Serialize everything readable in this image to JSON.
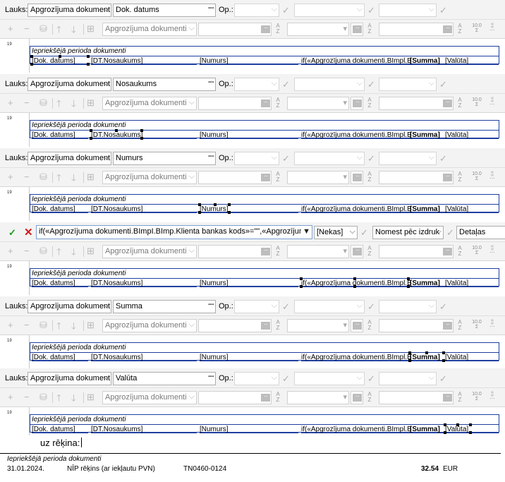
{
  "lauks_label": "Lauks:",
  "op_label": "Op.:",
  "table_name": "Apgrozījuma dokument",
  "toolbar2_combo": "Apgrozījuma dokumenti",
  "ruler_mark": "19",
  "band_header": "Iepriekšējā perioda dokumenti",
  "fields": {
    "dok_datums": "[Dok. datums]",
    "dt_nosaukums": "[DT.Nosaukums]",
    "numurs": "[Numurs]",
    "if_expr": "if(«Apgrozījuma dokumenti.BImpl.B",
    "summa": "[Summa]",
    "valuta": "[Valūta]"
  },
  "panels": [
    {
      "field": "Dok. datums",
      "selected": "dok_datums"
    },
    {
      "field": "Nosaukums",
      "selected": "dt_nosaukums"
    },
    {
      "field": "Numurs",
      "selected": "numurs"
    },
    {
      "field": "",
      "selected": "if_expr"
    },
    {
      "field": "Summa",
      "selected": "summa"
    },
    {
      "field": "Valūta",
      "selected": "valuta"
    }
  ],
  "edit_bar": {
    "expression": "if(«Apgrozījuma dokumenti.BImpI.BImp.Klienta bankas kods»=\"\",«Apgrozījuma dokuņ",
    "nekas": "[Nekas]",
    "nomest": "Nomest pēc izdruk",
    "detalas": "Detaļas"
  },
  "caption": "uz rēķina:",
  "preview": {
    "header": "Iepriekšējā perioda dokumenti",
    "date": "31.01.2024.",
    "doc_type": "NĪP rēķins (ar iekļautu PVN)",
    "number": "TN0460-0124",
    "amount": "32.54",
    "currency": "EUR"
  }
}
